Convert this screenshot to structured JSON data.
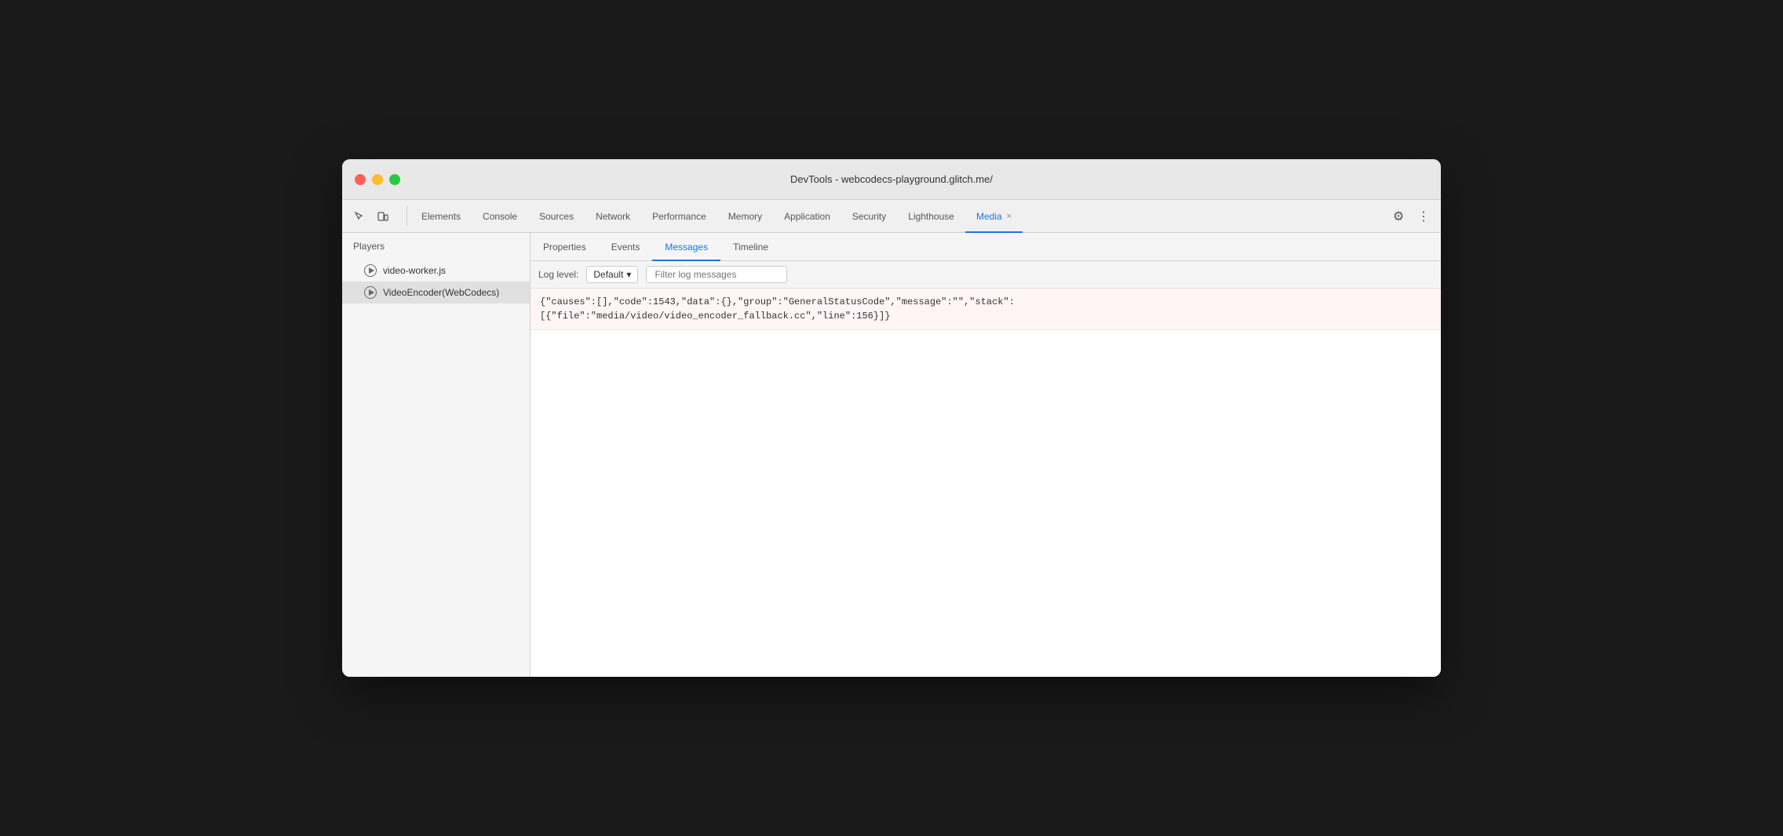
{
  "window": {
    "title": "DevTools - webcodecs-playground.glitch.me/"
  },
  "toolbar": {
    "tabs": [
      {
        "id": "elements",
        "label": "Elements",
        "active": false
      },
      {
        "id": "console",
        "label": "Console",
        "active": false
      },
      {
        "id": "sources",
        "label": "Sources",
        "active": false
      },
      {
        "id": "network",
        "label": "Network",
        "active": false
      },
      {
        "id": "performance",
        "label": "Performance",
        "active": false
      },
      {
        "id": "memory",
        "label": "Memory",
        "active": false
      },
      {
        "id": "application",
        "label": "Application",
        "active": false
      },
      {
        "id": "security",
        "label": "Security",
        "active": false
      },
      {
        "id": "lighthouse",
        "label": "Lighthouse",
        "active": false
      },
      {
        "id": "media",
        "label": "Media",
        "active": true,
        "closable": true
      }
    ],
    "settings_label": "⚙",
    "more_label": "⋮"
  },
  "sidebar": {
    "header": "Players",
    "items": [
      {
        "id": "video-worker",
        "label": "video-worker.js",
        "selected": false
      },
      {
        "id": "video-encoder",
        "label": "VideoEncoder(WebCodecs)",
        "selected": true
      }
    ]
  },
  "sub_tabs": [
    {
      "id": "properties",
      "label": "Properties",
      "active": false
    },
    {
      "id": "events",
      "label": "Events",
      "active": false
    },
    {
      "id": "messages",
      "label": "Messages",
      "active": true
    },
    {
      "id": "timeline",
      "label": "Timeline",
      "active": false
    }
  ],
  "filter_bar": {
    "log_level_label": "Log level:",
    "log_level_value": "Default",
    "log_level_arrow": "▾",
    "filter_placeholder": "Filter log messages"
  },
  "messages": [
    {
      "id": "msg-1",
      "line1": "{\"causes\":[],\"code\":1543,\"data\":{},\"group\":\"GeneralStatusCode\",\"message\":\"\",\"stack\":",
      "line2": "[{\"file\":\"media/video/video_encoder_fallback.cc\",\"line\":156}]}"
    }
  ]
}
